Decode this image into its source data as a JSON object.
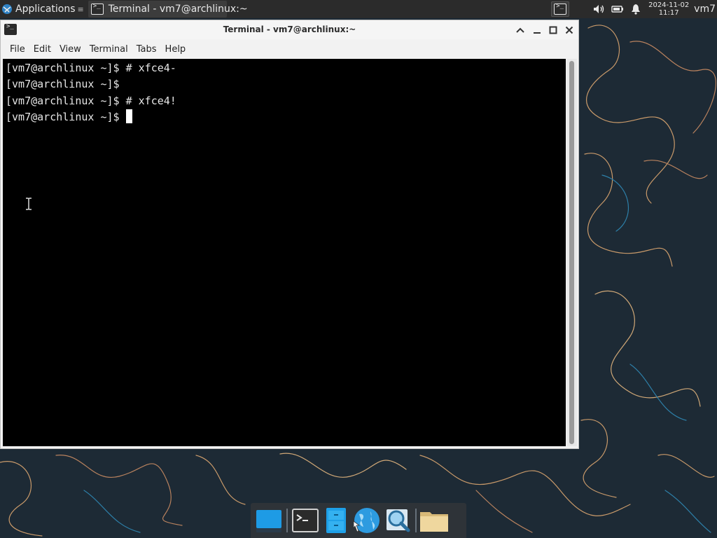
{
  "top_panel": {
    "applications_label": "Applications",
    "applications_glyph": "≡",
    "task_title": "Terminal - vm7@archlinux:~",
    "clock_date": "2024-11-02",
    "clock_time": "11:17",
    "user": "vm7",
    "tray_icons": [
      "volume-icon",
      "battery-icon",
      "notification-bell-icon"
    ]
  },
  "window": {
    "title": "Terminal - vm7@archlinux:~",
    "menu": [
      "File",
      "Edit",
      "View",
      "Terminal",
      "Tabs",
      "Help"
    ],
    "terminal_lines": [
      "[vm7@archlinux ~]$ # xfce4-",
      "[vm7@archlinux ~]$",
      "[vm7@archlinux ~]$ # xfce4!",
      "[vm7@archlinux ~]$ "
    ]
  },
  "dock": {
    "items": [
      "show-desktop-icon",
      "terminal-icon",
      "file-cabinet-icon",
      "web-browser-icon",
      "search-icon",
      "folder-icon"
    ]
  },
  "colors": {
    "panel": "#2b2b2b",
    "terminal_bg": "#000000",
    "terminal_fg": "#e6e6e6",
    "desktop": "#1e2b36",
    "accent": "#1e9be5"
  }
}
